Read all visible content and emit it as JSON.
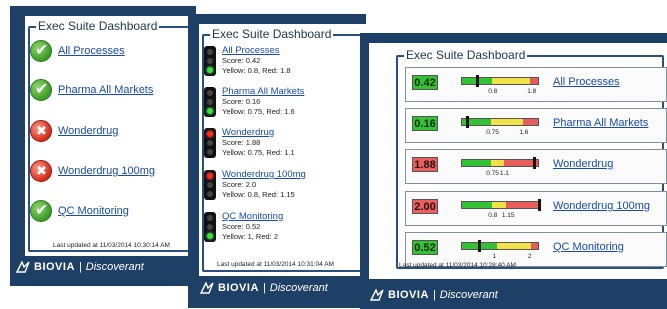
{
  "title": "Exec Suite Dashboard",
  "brand": "BIOVIA",
  "product": "Discoverant",
  "panel1": {
    "items": [
      {
        "label": "All Processes",
        "status": "ok"
      },
      {
        "label": "Pharma All Markets",
        "status": "ok"
      },
      {
        "label": "Wonderdrug",
        "status": "error"
      },
      {
        "label": "Wonderdrug 100mg",
        "status": "error"
      },
      {
        "label": "QC Monitoring",
        "status": "ok"
      }
    ],
    "updated": "Last updated at 11/03/2014 10:30:14 AM"
  },
  "panel2": {
    "items": [
      {
        "label": "All Processes",
        "score": "Score: 0.42",
        "thresholds": "Yellow: 0.8, Red: 1.8",
        "light": "green"
      },
      {
        "label": "Pharma All Markets",
        "score": "Score: 0.16",
        "thresholds": "Yellow: 0.75, Red: 1.6",
        "light": "green"
      },
      {
        "label": "Wonderdrug",
        "score": "Score: 1.88",
        "thresholds": "Yellow: 0.75, Red: 1.1",
        "light": "red"
      },
      {
        "label": "Wonderdrug 100mg",
        "score": "Score: 2.0",
        "thresholds": "Yellow: 0.8, Red: 1.15",
        "light": "red"
      },
      {
        "label": "QC Monitoring",
        "score": "Score: 0.52",
        "thresholds": "Yellow: 1, Red: 2",
        "light": "green"
      }
    ],
    "updated": "Last updated at 11/03/2014 10:31:04 AM"
  },
  "panel3": {
    "items": [
      {
        "label": "All Processes",
        "score": "0.42",
        "status": "green",
        "yellow": "0.8",
        "red": "1.8",
        "value": 0.42,
        "y": 0.8,
        "r": 1.8,
        "max": 2.0
      },
      {
        "label": "Pharma All Markets",
        "score": "0.16",
        "status": "green",
        "yellow": "0.75",
        "red": "1.6",
        "value": 0.16,
        "y": 0.75,
        "r": 1.6,
        "max": 2.0
      },
      {
        "label": "Wonderdrug",
        "score": "1.88",
        "status": "red",
        "yellow": "0.75",
        "red": "1.1",
        "value": 1.88,
        "y": 0.75,
        "r": 1.1,
        "max": 2.0
      },
      {
        "label": "Wonderdrug 100mg",
        "score": "2.00",
        "status": "red",
        "yellow": "0.8",
        "red": "1.15",
        "value": 2.0,
        "y": 0.8,
        "r": 1.15,
        "max": 2.0
      },
      {
        "label": "QC Monitoring",
        "score": "0.52",
        "status": "green",
        "yellow": "1",
        "red": "2",
        "value": 0.52,
        "y": 1.0,
        "r": 2.0,
        "max": 2.2
      }
    ],
    "updated": "Last updated at 11/03/2014 10:28:40 AM"
  },
  "colors": {
    "frame": "#1e3f66",
    "link": "#1a4bb0",
    "green": "#33c233",
    "yellow": "#f2e24a",
    "red": "#e85c5c"
  }
}
